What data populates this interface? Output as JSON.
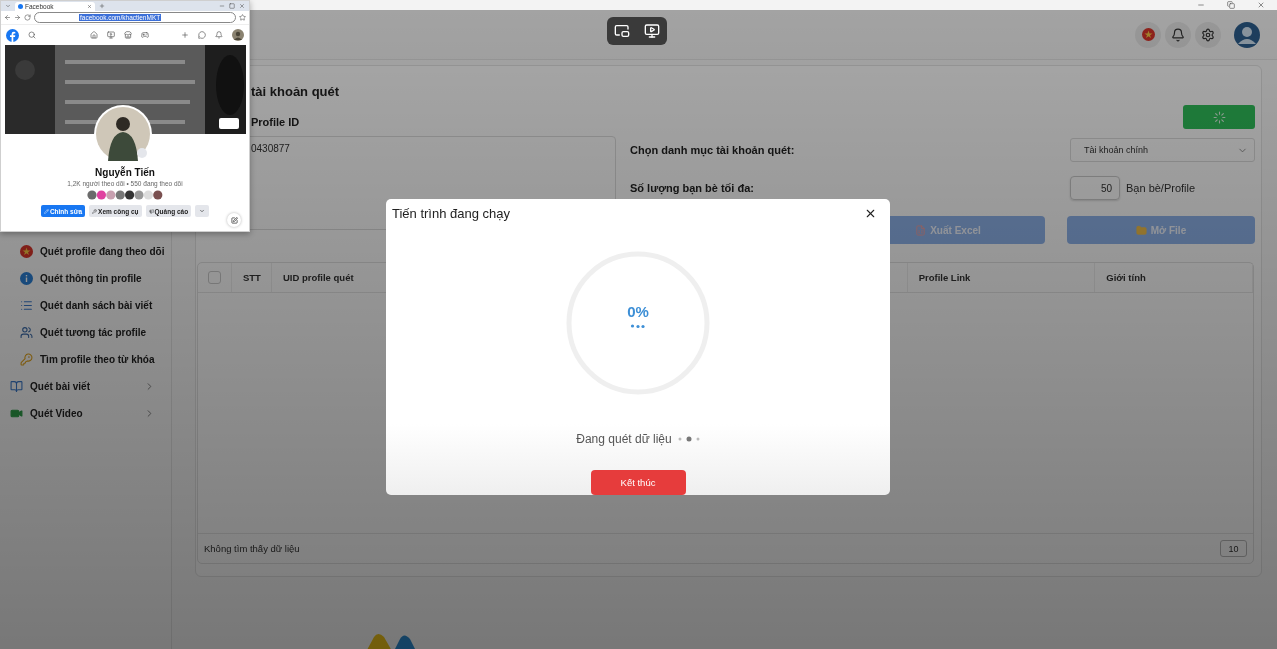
{
  "sidebar": {
    "items": [
      {
        "label": "Quét profile đang theo dõi",
        "kind": "sub"
      },
      {
        "label": "Quét thông tin profile",
        "kind": "sub"
      },
      {
        "label": "Quét danh sách bài viết",
        "kind": "sub"
      },
      {
        "label": "Quét tương tác profile",
        "kind": "sub"
      },
      {
        "label": "Tìm profile theo từ khóa",
        "kind": "sub"
      },
      {
        "label": "Quét bài viết",
        "kind": "group",
        "expanded": false
      },
      {
        "label": "Quét Video",
        "kind": "group",
        "expanded": false
      }
    ]
  },
  "form": {
    "heading": "tài khoản quét",
    "profile_id_label": "Profile ID",
    "profile_ids": "0430877",
    "start_button": {
      "loading": true
    },
    "category": {
      "label": "Chọn danh mục tài khoản quét:",
      "value": "Tài khoản chính"
    },
    "max_friends": {
      "label": "Số lượng bạn bè tối đa:",
      "value": "50",
      "unit": "Bạn bè/Profile"
    },
    "buttons": [
      {
        "label": "Xuất Excel",
        "kind": "excel"
      },
      {
        "label": "Mở File",
        "kind": "folder"
      }
    ]
  },
  "table": {
    "select_all": {
      "checked": false
    },
    "columns": [
      "STT",
      "UID profile quét",
      "Profile Link",
      "Giới tính"
    ],
    "empty_text": "Không tìm thấy dữ liệu",
    "page_size": "10"
  },
  "browser": {
    "tab_title": "Facebook",
    "url": "facebook.com/khactienMKT",
    "profile": {
      "name": "Nguyễn Tiến",
      "stats": "1,2K người theo dõi • 550 đang theo dõi",
      "buttons": [
        {
          "label": "Chỉnh sửa",
          "kind": "primary"
        },
        {
          "label": "Xem công cụ",
          "kind": "secondary"
        },
        {
          "label": "Quảng cáo",
          "kind": "secondary"
        }
      ]
    }
  },
  "modal": {
    "title": "Tiến trình đang chạy",
    "progress": {
      "level": 0,
      "percent": "0%"
    },
    "status": "Đang quét dữ liệu",
    "stop_button": "Kết thúc"
  }
}
